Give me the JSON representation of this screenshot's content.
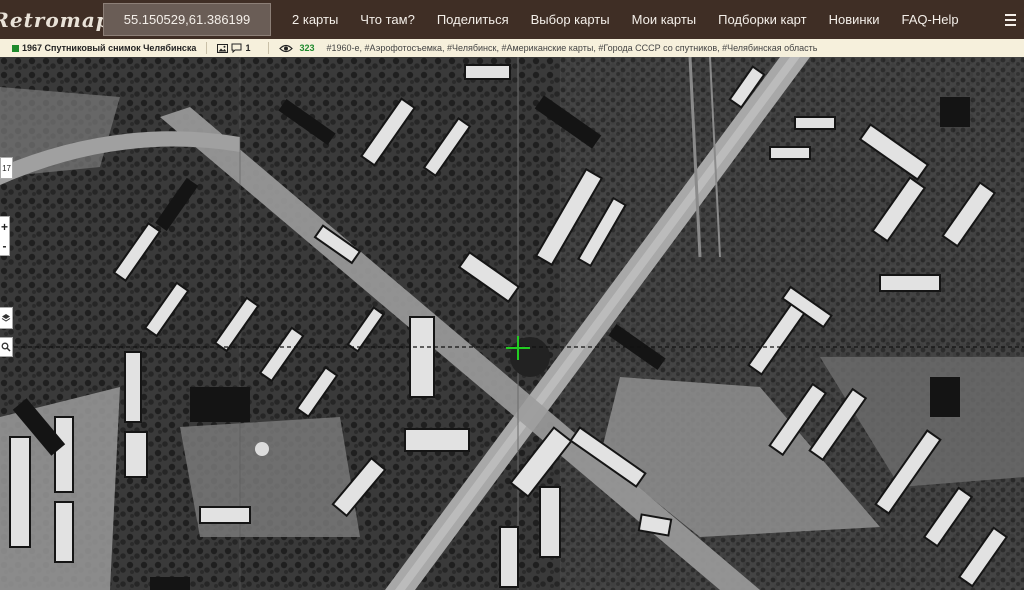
{
  "header": {
    "logo": "Retromap",
    "coordinates": "55.150529,61.386199",
    "nav": [
      {
        "label": "2 карты"
      },
      {
        "label": "Что там?"
      },
      {
        "label": "Поделиться"
      },
      {
        "label": "Выбор карты"
      },
      {
        "label": "Мои карты"
      },
      {
        "label": "Подборки карт"
      },
      {
        "label": "Новинки"
      },
      {
        "label": "FAQ-Help"
      }
    ],
    "menu_icon": "hamburger-icon"
  },
  "info": {
    "title": "1967 Спутниковый снимок Челябинска",
    "image_icon": "image-icon",
    "comment_icon": "comment-icon",
    "comments": "1",
    "eye_icon": "eye-icon",
    "views": "323",
    "tags": "#1960-е, #Аэрофотосъемка, #Челябинск, #Американские карты, #Города СССР со спутников, #Челябинская область",
    "accent_color": "#1f8a2d"
  },
  "map": {
    "zoom": "17",
    "zoom_in": "+",
    "zoom_out": "-",
    "layers_icon": "layers-icon",
    "search_icon": "search-icon",
    "crosshair_icon": "crosshair-icon",
    "crosshair_color": "#22cc22"
  }
}
